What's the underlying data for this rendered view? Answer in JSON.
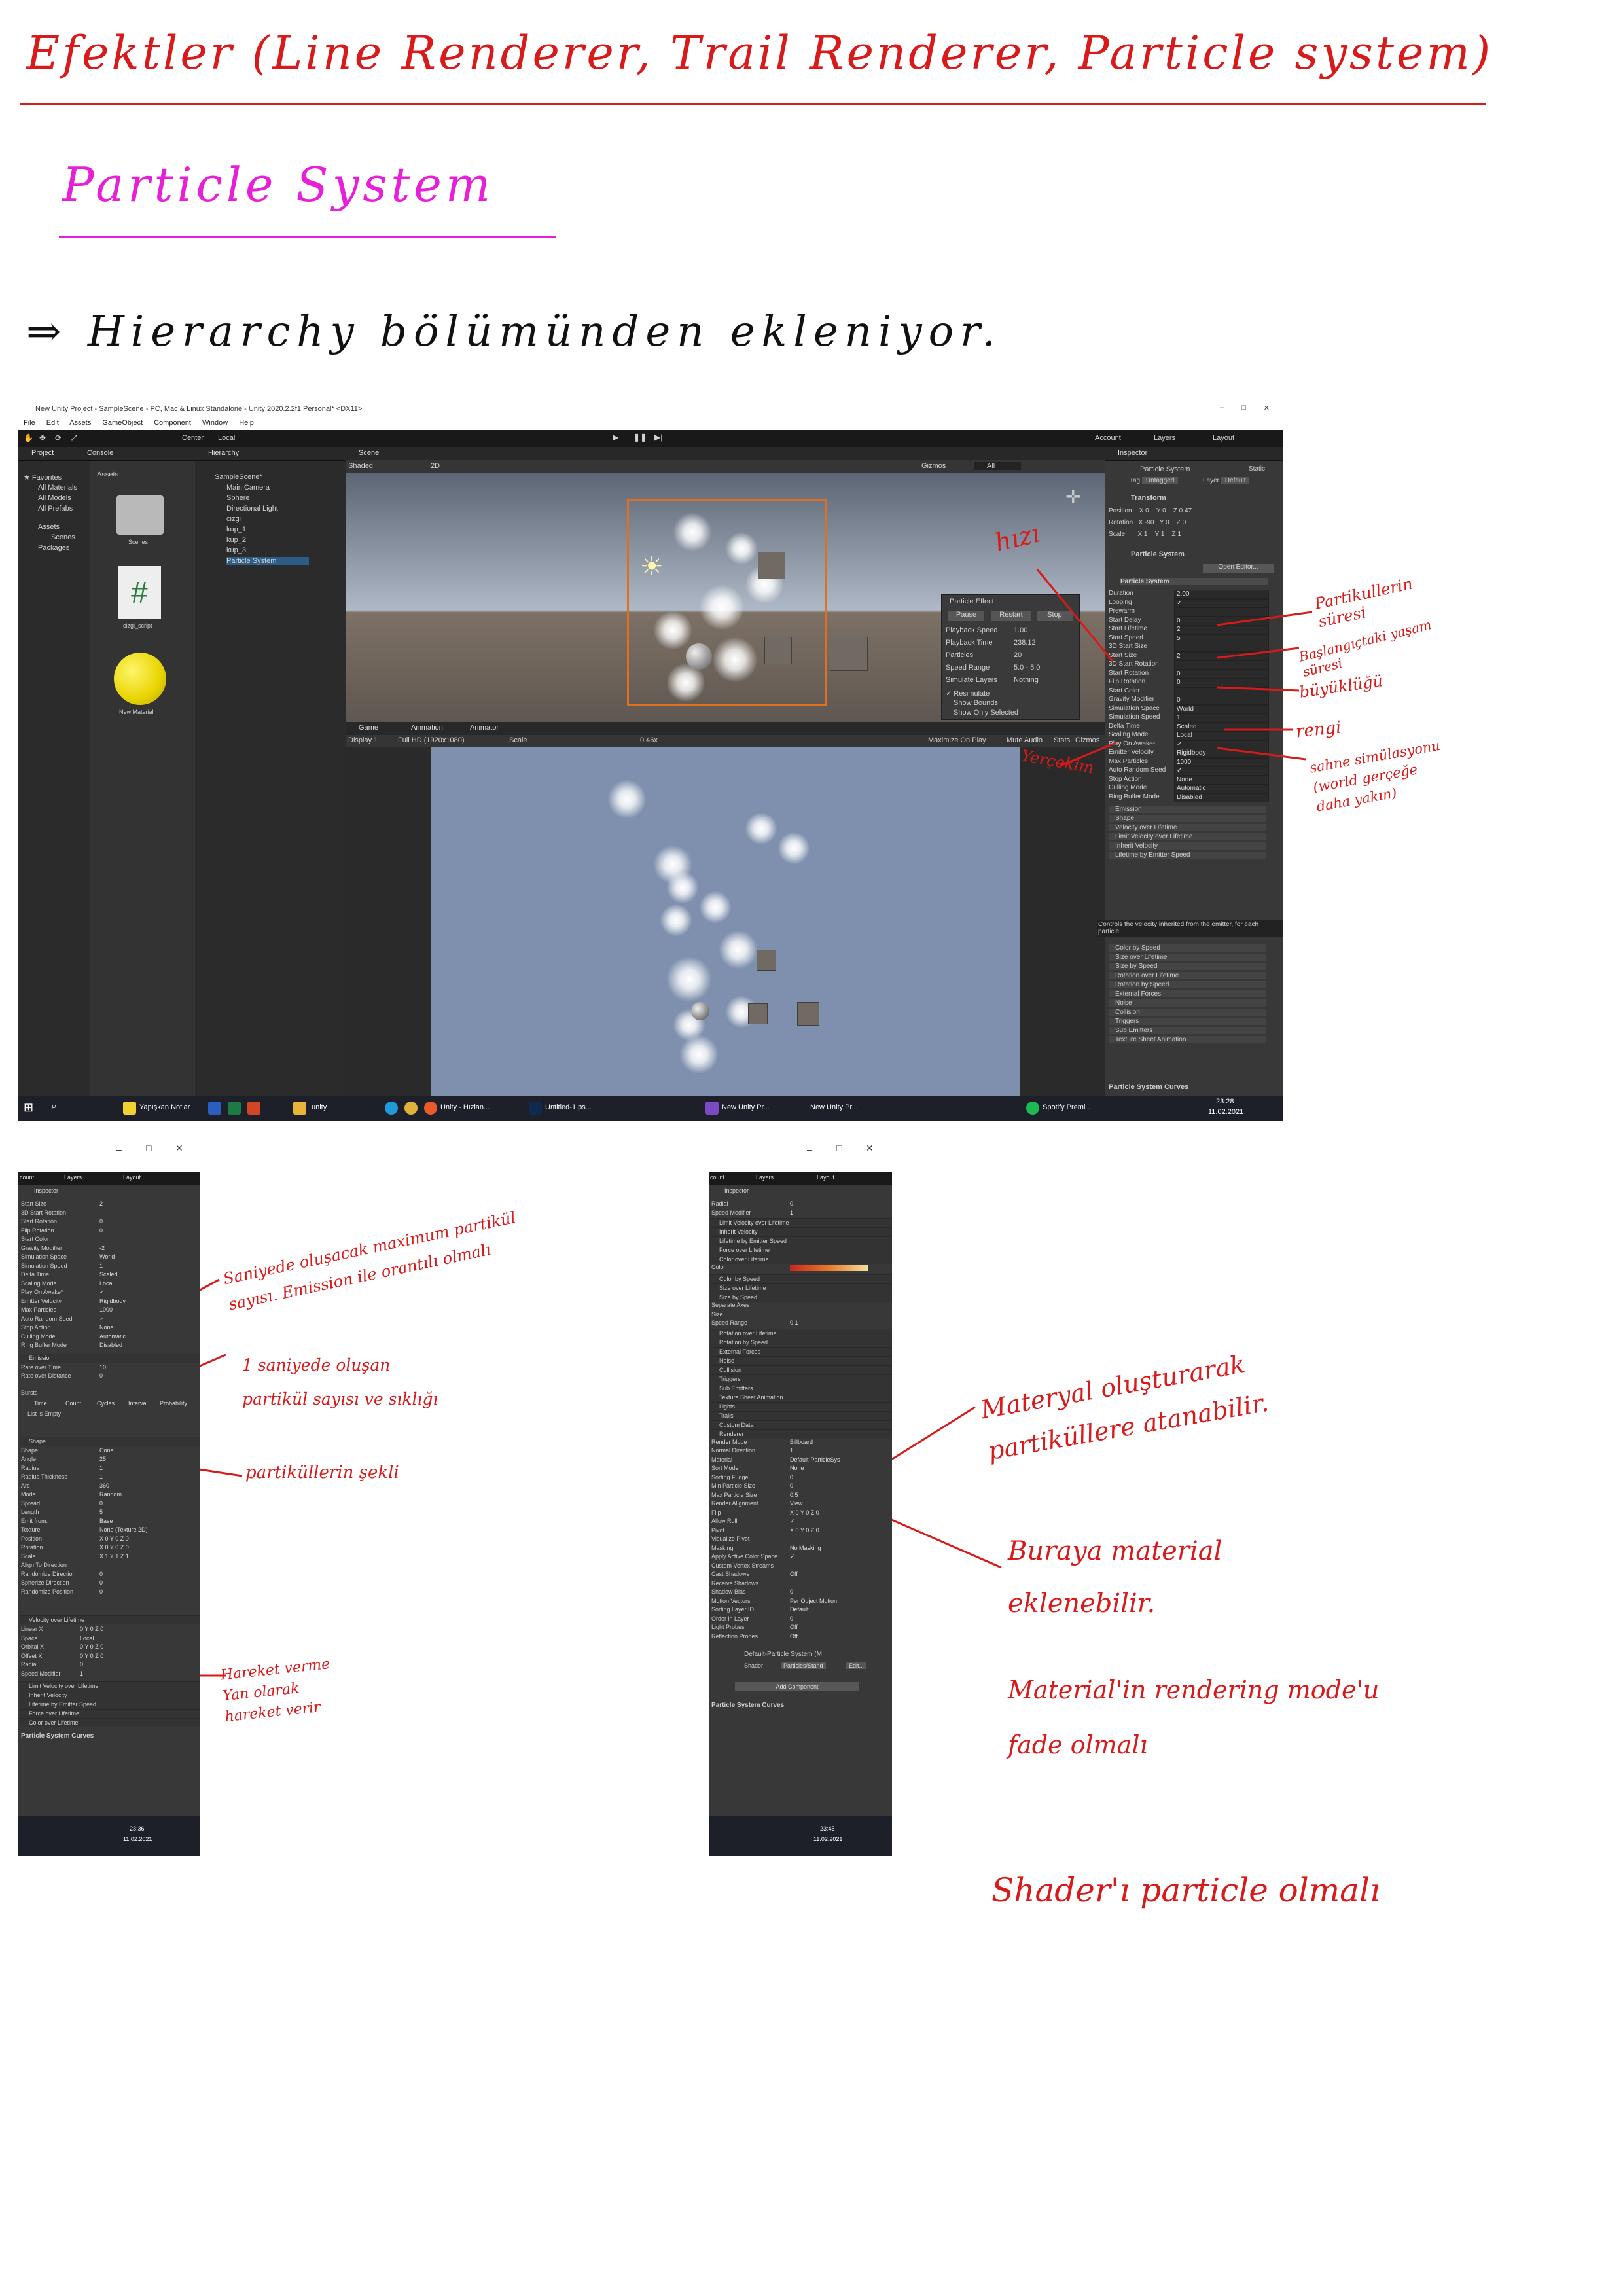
{
  "notes": {
    "heading": "Efektler (Line Renderer, Trail Renderer, Particle system)",
    "subheading": "Particle System",
    "line1": "⇒ Hierarchy bölümünden ekleniyor.",
    "hizi": "hızı",
    "yercekim": "Yerçekim",
    "partikullerin_suresi": "Partikullerin süresi",
    "baslangic_suresi": "Başlangıçtaki yaşam süresi",
    "buyuklugu": "büyüklüğü",
    "rengi": "rengi",
    "sahne": "sahne simülasyonu (world gerçeğe daha yakın)",
    "saniyede": "Saniyede oluşacak maximum partikül sayısı. Emission ile orantılı olmalı",
    "bir_saniyede": "1 saniyede oluşan partikül sayısı ve sıklığı",
    "sekli": "partiküllerin şekli",
    "hareket": "Hareket verme Yan olarak hareket verir",
    "materyal": "Materyal oluşturarak partiküllere atanabilir.",
    "buraya": "Buraya material eklenebilir.",
    "material_rendering": "Material'in rendering mode'u fade olmalı",
    "shader": "Shader'ı particle olmalı"
  },
  "unity": {
    "window_title": "New Unity Project - SampleScene - PC, Mac & Linux Standalone - Unity 2020.2.2f1 Personal* <DX11>",
    "menu": [
      "File",
      "Edit",
      "Assets",
      "GameObject",
      "Component",
      "Window",
      "Help"
    ],
    "toolbar": {
      "center": "Center",
      "local": "Local",
      "account": "Account",
      "layers": "Layers",
      "layout": "Layout"
    },
    "project": {
      "tab_project": "Project",
      "tab_console": "Console",
      "favorites": "Favorites",
      "favorite_items": [
        "All Materials",
        "All Models",
        "All Prefabs"
      ],
      "assets": "Assets",
      "asset_children": [
        "Scenes"
      ],
      "packages": "Packages",
      "assets_header": "Assets",
      "files": [
        "Scenes",
        "cizgi_script",
        "New Material"
      ]
    },
    "hierarchy": {
      "tab": "Hierarchy",
      "scene": "SampleScene*",
      "items": [
        "Main Camera",
        "Sphere",
        "Directional Light",
        "cizgi",
        "kup_1",
        "kup_2",
        "kup_3",
        "Particle System"
      ]
    },
    "scene_view": {
      "tab": "Scene",
      "shading": "Shaded",
      "mode_2d": "2D",
      "gizmos": "Gizmos",
      "search": "All"
    },
    "particle_effect": {
      "title": "Particle Effect",
      "buttons": [
        "Pause",
        "Restart",
        "Stop"
      ],
      "rows": [
        {
          "label": "Playback Speed",
          "value": "1.00"
        },
        {
          "label": "Playback Time",
          "value": "238.12"
        },
        {
          "label": "Particles",
          "value": "20"
        },
        {
          "label": "Speed Range",
          "value": "5.0 - 5.0"
        },
        {
          "label": "Simulate Layers",
          "value": "Nothing"
        }
      ],
      "checks": [
        "Resimulate",
        "Show Bounds",
        "Show Only Selected"
      ]
    },
    "game_view": {
      "tabs": [
        "Game",
        "Animation",
        "Animator"
      ],
      "display": "Display 1",
      "resolution": "Full HD (1920x1080)",
      "scale": "Scale",
      "scale_value": "0.46x",
      "options": [
        "Maximize On Play",
        "Mute Audio",
        "Stats",
        "Gizmos"
      ]
    },
    "inspector": {
      "tab": "Inspector",
      "object_name": "Particle System",
      "static": "Static",
      "tag": "Untagged",
      "layer": "Default",
      "transform": "Transform",
      "position": [
        "0",
        "0",
        "0.47"
      ],
      "rotation": [
        "-90",
        "0",
        "0"
      ],
      "scale": [
        "1",
        "1",
        "1"
      ],
      "component": "Particle System",
      "open_editor": "Open Editor...",
      "main_module": "Particle System",
      "fields": [
        {
          "label": "Duration",
          "value": "2.00"
        },
        {
          "label": "Looping",
          "value": "✓"
        },
        {
          "label": "Prewarm",
          "value": ""
        },
        {
          "label": "Start Delay",
          "value": "0"
        },
        {
          "label": "Start Lifetime",
          "value": "2"
        },
        {
          "label": "Start Speed",
          "value": "5"
        },
        {
          "label": "3D Start Size",
          "value": ""
        },
        {
          "label": "Start Size",
          "value": "2"
        },
        {
          "label": "3D Start Rotation",
          "value": ""
        },
        {
          "label": "Start Rotation",
          "value": "0"
        },
        {
          "label": "Flip Rotation",
          "value": "0"
        },
        {
          "label": "Start Color",
          "value": ""
        },
        {
          "label": "Gravity Modifier",
          "value": "0"
        },
        {
          "label": "Simulation Space",
          "value": "World"
        },
        {
          "label": "Simulation Speed",
          "value": "1"
        },
        {
          "label": "Delta Time",
          "value": "Scaled"
        },
        {
          "label": "Scaling Mode",
          "value": "Local"
        },
        {
          "label": "Play On Awake*",
          "value": "✓"
        },
        {
          "label": "Emitter Velocity",
          "value": "Rigidbody"
        },
        {
          "label": "Max Particles",
          "value": "1000"
        },
        {
          "label": "Auto Random Seed",
          "value": "✓"
        },
        {
          "label": "Stop Action",
          "value": "None"
        },
        {
          "label": "Culling Mode",
          "value": "Automatic"
        },
        {
          "label": "Ring Buffer Mode",
          "value": "Disabled"
        }
      ],
      "modules": [
        "Emission",
        "Shape",
        "Velocity over Lifetime",
        "Limit Velocity over Lifetime",
        "Inherit Velocity",
        "Lifetime by Emitter Speed"
      ],
      "tooltip": "Controls the velocity inherited from the emitter, for each particle.",
      "modules2": [
        "Color by Speed",
        "Size over Lifetime",
        "Size by Speed",
        "Rotation over Lifetime",
        "Rotation by Speed",
        "External Forces",
        "Noise",
        "Collision",
        "Triggers",
        "Sub Emitters",
        "Texture Sheet Animation"
      ],
      "curves": "Particle System Curves"
    },
    "taskbar": {
      "items": [
        "Yapışkan Notlar",
        "unity",
        "Unity - Hızlan...",
        "Untitled-1.ps...",
        "New Unity Pr...",
        "New Unity Pr...",
        "Spotify Premi..."
      ],
      "time": "23:28",
      "date": "11.02.2021"
    }
  },
  "left_window": {
    "toolbar": [
      "count",
      "Layers",
      "Layout"
    ],
    "tab": "Inspector",
    "rows": [
      {
        "label": "Start Size",
        "value": "2"
      },
      {
        "label": "3D Start Rotation",
        "value": ""
      },
      {
        "label": "Start Rotation",
        "value": "0"
      },
      {
        "label": "Flip Rotation",
        "value": "0"
      },
      {
        "label": "Start Color",
        "value": ""
      },
      {
        "label": "Gravity Modifier",
        "value": "-2"
      },
      {
        "label": "Simulation Space",
        "value": "World"
      },
      {
        "label": "Simulation Speed",
        "value": "1"
      },
      {
        "label": "Delta Time",
        "value": "Scaled"
      },
      {
        "label": "Scaling Mode",
        "value": "Local"
      },
      {
        "label": "Play On Awake*",
        "value": "✓"
      },
      {
        "label": "Emitter Velocity",
        "value": "Rigidbody"
      },
      {
        "label": "Max Particles",
        "value": "1000"
      },
      {
        "label": "Auto Random Seed",
        "value": "✓"
      },
      {
        "label": "Stop Action",
        "value": "None"
      },
      {
        "label": "Culling Mode",
        "value": "Automatic"
      },
      {
        "label": "Ring Buffer Mode",
        "value": "Disabled"
      }
    ],
    "emission": "Emission",
    "emission_rows": [
      {
        "label": "Rate over Time",
        "value": "10"
      },
      {
        "label": "Rate over Distance",
        "value": "0"
      }
    ],
    "bursts": "Bursts",
    "burst_cols": [
      "Time",
      "Count",
      "Cycles",
      "Interval",
      "Probability"
    ],
    "list_empty": "List is Empty",
    "shape": "Shape",
    "shape_rows": [
      {
        "label": "Shape",
        "value": "Cone"
      },
      {
        "label": "Angle",
        "value": "25"
      },
      {
        "label": "Radius",
        "value": "1"
      },
      {
        "label": "Radius Thickness",
        "value": "1"
      },
      {
        "label": "Arc",
        "value": "360"
      },
      {
        "label": "Mode",
        "value": "Random"
      },
      {
        "label": "Spread",
        "value": "0"
      },
      {
        "label": "Length",
        "value": "5"
      },
      {
        "label": "Emit from:",
        "value": "Base"
      },
      {
        "label": "Texture",
        "value": "None (Texture 2D)"
      },
      {
        "label": "Position",
        "value": "X 0  Y 0  Z 0"
      },
      {
        "label": "Rotation",
        "value": "X 0  Y 0  Z 0"
      },
      {
        "label": "Scale",
        "value": "X 1  Y 1  Z 1"
      },
      {
        "label": "Align To Direction",
        "value": ""
      },
      {
        "label": "Randomize Direction",
        "value": "0"
      },
      {
        "label": "Spherize Direction",
        "value": "0"
      },
      {
        "label": "Randomize Position",
        "value": "0"
      }
    ],
    "velocity": "Velocity over Lifetime",
    "velocity_rows": [
      {
        "label": "Linear X",
        "value": "0   Y 0   Z 0"
      },
      {
        "label": "Space",
        "value": "Local"
      },
      {
        "label": "Orbital X",
        "value": "0   Y 0   Z 0"
      },
      {
        "label": "Offset X",
        "value": "0   Y 0   Z 0"
      },
      {
        "label": "Radial",
        "value": "0"
      },
      {
        "label": "Speed Modifier",
        "value": "1"
      }
    ],
    "more_modules": [
      "Limit Velocity over Lifetime",
      "Inherit Velocity",
      "Lifetime by Emitter Speed",
      "Force over Lifetime",
      "Color over Lifetime"
    ],
    "curves": "Particle System Curves",
    "time": "23:36",
    "date": "11.02.2021"
  },
  "right_window": {
    "toolbar": [
      "count",
      "Layers",
      "Layout"
    ],
    "tab": "Inspector",
    "top_rows": [
      {
        "label": "Radial",
        "value": "0"
      },
      {
        "label": "Speed Modifier",
        "value": "1"
      }
    ],
    "modules_a": [
      "Limit Velocity over Lifetime",
      "Inherit Velocity",
      "Lifetime by Emitter Speed",
      "Force over Lifetime",
      "Color over Lifetime"
    ],
    "color_label": "Color",
    "modules_b": [
      "Color by Speed",
      "Size over Lifetime",
      "Size by Speed"
    ],
    "size_rows": [
      {
        "label": "Separate Axes",
        "value": ""
      },
      {
        "label": "Size",
        "value": ""
      },
      {
        "label": "Speed Range",
        "value": "0   1"
      }
    ],
    "modules_c": [
      "Rotation over Lifetime",
      "Rotation by Speed",
      "External Forces",
      "Noise",
      "Collision",
      "Triggers",
      "Sub Emitters",
      "Texture Sheet Animation",
      "Lights",
      "Trails",
      "Custom Data",
      "Renderer"
    ],
    "renderer_rows": [
      {
        "label": "Render Mode",
        "value": "Billboard"
      },
      {
        "label": "Normal Direction",
        "value": "1"
      },
      {
        "label": "Material",
        "value": "Default-ParticleSys"
      },
      {
        "label": "Sort Mode",
        "value": "None"
      },
      {
        "label": "Sorting Fudge",
        "value": "0"
      },
      {
        "label": "Min Particle Size",
        "value": "0"
      },
      {
        "label": "Max Particle Size",
        "value": "0.5"
      },
      {
        "label": "Render Alignment",
        "value": "View"
      },
      {
        "label": "Flip",
        "value": "X 0  Y 0  Z 0"
      },
      {
        "label": "Allow Roll",
        "value": "✓"
      },
      {
        "label": "Pivot",
        "value": "X 0  Y 0  Z 0"
      },
      {
        "label": "Visualize Pivot",
        "value": ""
      },
      {
        "label": "Masking",
        "value": "No Masking"
      },
      {
        "label": "Apply Active Color Space",
        "value": "✓"
      },
      {
        "label": "Custom Vertex Streams",
        "value": ""
      },
      {
        "label": "Cast Shadows",
        "value": "Off"
      },
      {
        "label": "Receive Shadows",
        "value": ""
      },
      {
        "label": "Shadow Bias",
        "value": "0"
      },
      {
        "label": "Motion Vectors",
        "value": "Per Object Motion"
      },
      {
        "label": "Sorting Layer ID",
        "value": "Default"
      },
      {
        "label": "Order in Layer",
        "value": "0"
      },
      {
        "label": "Light Probes",
        "value": "Off"
      },
      {
        "label": "Reflection Probes",
        "value": "Off"
      }
    ],
    "material_name": "Default-Particle System (M",
    "shader_label": "Shader",
    "shader_value": "Particles/Stand",
    "edit": "Edit...",
    "add_component": "Add Component",
    "curves": "Particle System Curves",
    "time": "23:45",
    "date": "11.02.2021"
  }
}
